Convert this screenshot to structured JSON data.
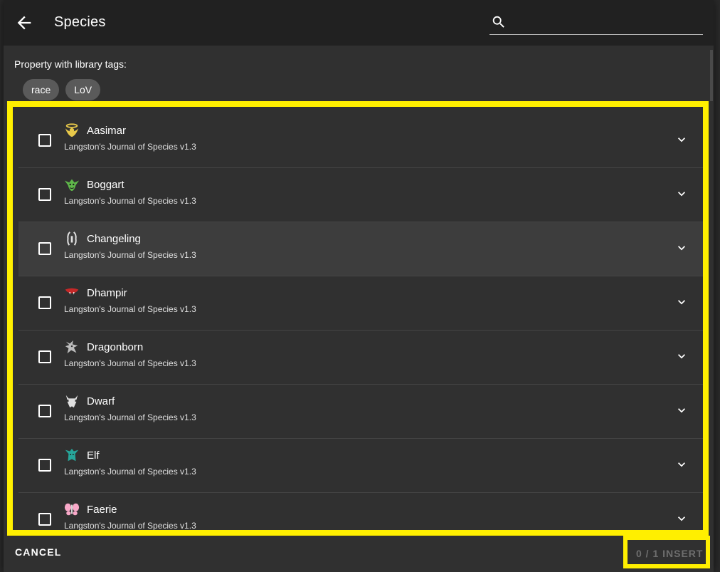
{
  "toolbar": {
    "title": "Species",
    "search_value": ""
  },
  "filter": {
    "label": "Property with library tags:",
    "tags": [
      "race",
      "LoV"
    ]
  },
  "list": {
    "items": [
      {
        "name": "Aasimar",
        "source": "Langston's Journal of Species v1.3",
        "icon": "aasimar-icon",
        "color": "#e8c94a"
      },
      {
        "name": "Boggart",
        "source": "Langston's Journal of Species v1.3",
        "icon": "boggart-icon",
        "color": "#5fb84a"
      },
      {
        "name": "Changeling",
        "source": "Langston's Journal of Species v1.3",
        "icon": "changeling-icon",
        "color": "#e0e0e0"
      },
      {
        "name": "Dhampir",
        "source": "Langston's Journal of Species v1.3",
        "icon": "dhampir-icon",
        "color": "#c62828"
      },
      {
        "name": "Dragonborn",
        "source": "Langston's Journal of Species v1.3",
        "icon": "dragonborn-icon",
        "color": "#bdbdbd"
      },
      {
        "name": "Dwarf",
        "source": "Langston's Journal of Species v1.3",
        "icon": "dwarf-icon",
        "color": "#e0e0e0"
      },
      {
        "name": "Elf",
        "source": "Langston's Journal of Species v1.3",
        "icon": "elf-icon",
        "color": "#26a69a"
      },
      {
        "name": "Faerie",
        "source": "Langston's Journal of Species v1.3",
        "icon": "faerie-icon",
        "color": "#f8a8c8"
      }
    ]
  },
  "footer": {
    "cancel_label": "CANCEL",
    "insert_label": "0 / 1 INSERT"
  },
  "colors": {
    "highlight": "#ffef00",
    "dialog_bg": "#303030",
    "toolbar_bg": "#212121"
  }
}
